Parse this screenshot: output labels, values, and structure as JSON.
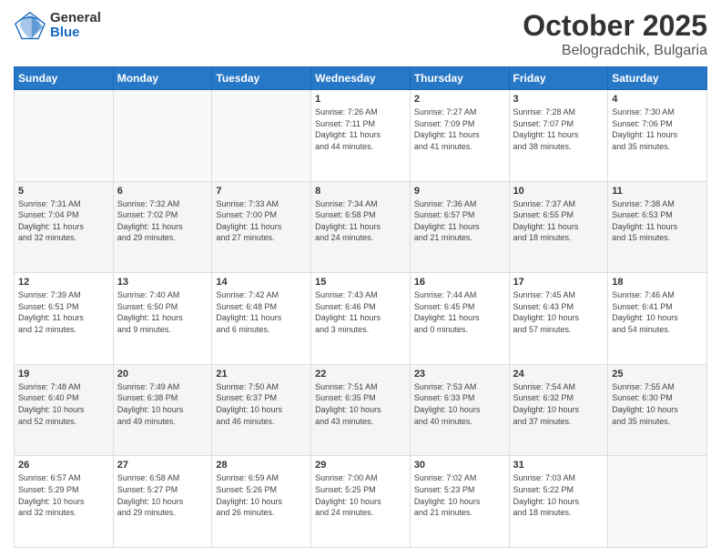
{
  "header": {
    "logo_general": "General",
    "logo_blue": "Blue",
    "title": "October 2025",
    "subtitle": "Belogradchik, Bulgaria"
  },
  "days_of_week": [
    "Sunday",
    "Monday",
    "Tuesday",
    "Wednesday",
    "Thursday",
    "Friday",
    "Saturday"
  ],
  "weeks": [
    [
      {
        "day": "",
        "info": ""
      },
      {
        "day": "",
        "info": ""
      },
      {
        "day": "",
        "info": ""
      },
      {
        "day": "1",
        "info": "Sunrise: 7:26 AM\nSunset: 7:11 PM\nDaylight: 11 hours\nand 44 minutes."
      },
      {
        "day": "2",
        "info": "Sunrise: 7:27 AM\nSunset: 7:09 PM\nDaylight: 11 hours\nand 41 minutes."
      },
      {
        "day": "3",
        "info": "Sunrise: 7:28 AM\nSunset: 7:07 PM\nDaylight: 11 hours\nand 38 minutes."
      },
      {
        "day": "4",
        "info": "Sunrise: 7:30 AM\nSunset: 7:06 PM\nDaylight: 11 hours\nand 35 minutes."
      }
    ],
    [
      {
        "day": "5",
        "info": "Sunrise: 7:31 AM\nSunset: 7:04 PM\nDaylight: 11 hours\nand 32 minutes."
      },
      {
        "day": "6",
        "info": "Sunrise: 7:32 AM\nSunset: 7:02 PM\nDaylight: 11 hours\nand 29 minutes."
      },
      {
        "day": "7",
        "info": "Sunrise: 7:33 AM\nSunset: 7:00 PM\nDaylight: 11 hours\nand 27 minutes."
      },
      {
        "day": "8",
        "info": "Sunrise: 7:34 AM\nSunset: 6:58 PM\nDaylight: 11 hours\nand 24 minutes."
      },
      {
        "day": "9",
        "info": "Sunrise: 7:36 AM\nSunset: 6:57 PM\nDaylight: 11 hours\nand 21 minutes."
      },
      {
        "day": "10",
        "info": "Sunrise: 7:37 AM\nSunset: 6:55 PM\nDaylight: 11 hours\nand 18 minutes."
      },
      {
        "day": "11",
        "info": "Sunrise: 7:38 AM\nSunset: 6:53 PM\nDaylight: 11 hours\nand 15 minutes."
      }
    ],
    [
      {
        "day": "12",
        "info": "Sunrise: 7:39 AM\nSunset: 6:51 PM\nDaylight: 11 hours\nand 12 minutes."
      },
      {
        "day": "13",
        "info": "Sunrise: 7:40 AM\nSunset: 6:50 PM\nDaylight: 11 hours\nand 9 minutes."
      },
      {
        "day": "14",
        "info": "Sunrise: 7:42 AM\nSunset: 6:48 PM\nDaylight: 11 hours\nand 6 minutes."
      },
      {
        "day": "15",
        "info": "Sunrise: 7:43 AM\nSunset: 6:46 PM\nDaylight: 11 hours\nand 3 minutes."
      },
      {
        "day": "16",
        "info": "Sunrise: 7:44 AM\nSunset: 6:45 PM\nDaylight: 11 hours\nand 0 minutes."
      },
      {
        "day": "17",
        "info": "Sunrise: 7:45 AM\nSunset: 6:43 PM\nDaylight: 10 hours\nand 57 minutes."
      },
      {
        "day": "18",
        "info": "Sunrise: 7:46 AM\nSunset: 6:41 PM\nDaylight: 10 hours\nand 54 minutes."
      }
    ],
    [
      {
        "day": "19",
        "info": "Sunrise: 7:48 AM\nSunset: 6:40 PM\nDaylight: 10 hours\nand 52 minutes."
      },
      {
        "day": "20",
        "info": "Sunrise: 7:49 AM\nSunset: 6:38 PM\nDaylight: 10 hours\nand 49 minutes."
      },
      {
        "day": "21",
        "info": "Sunrise: 7:50 AM\nSunset: 6:37 PM\nDaylight: 10 hours\nand 46 minutes."
      },
      {
        "day": "22",
        "info": "Sunrise: 7:51 AM\nSunset: 6:35 PM\nDaylight: 10 hours\nand 43 minutes."
      },
      {
        "day": "23",
        "info": "Sunrise: 7:53 AM\nSunset: 6:33 PM\nDaylight: 10 hours\nand 40 minutes."
      },
      {
        "day": "24",
        "info": "Sunrise: 7:54 AM\nSunset: 6:32 PM\nDaylight: 10 hours\nand 37 minutes."
      },
      {
        "day": "25",
        "info": "Sunrise: 7:55 AM\nSunset: 6:30 PM\nDaylight: 10 hours\nand 35 minutes."
      }
    ],
    [
      {
        "day": "26",
        "info": "Sunrise: 6:57 AM\nSunset: 5:29 PM\nDaylight: 10 hours\nand 32 minutes."
      },
      {
        "day": "27",
        "info": "Sunrise: 6:58 AM\nSunset: 5:27 PM\nDaylight: 10 hours\nand 29 minutes."
      },
      {
        "day": "28",
        "info": "Sunrise: 6:59 AM\nSunset: 5:26 PM\nDaylight: 10 hours\nand 26 minutes."
      },
      {
        "day": "29",
        "info": "Sunrise: 7:00 AM\nSunset: 5:25 PM\nDaylight: 10 hours\nand 24 minutes."
      },
      {
        "day": "30",
        "info": "Sunrise: 7:02 AM\nSunset: 5:23 PM\nDaylight: 10 hours\nand 21 minutes."
      },
      {
        "day": "31",
        "info": "Sunrise: 7:03 AM\nSunset: 5:22 PM\nDaylight: 10 hours\nand 18 minutes."
      },
      {
        "day": "",
        "info": ""
      }
    ]
  ]
}
